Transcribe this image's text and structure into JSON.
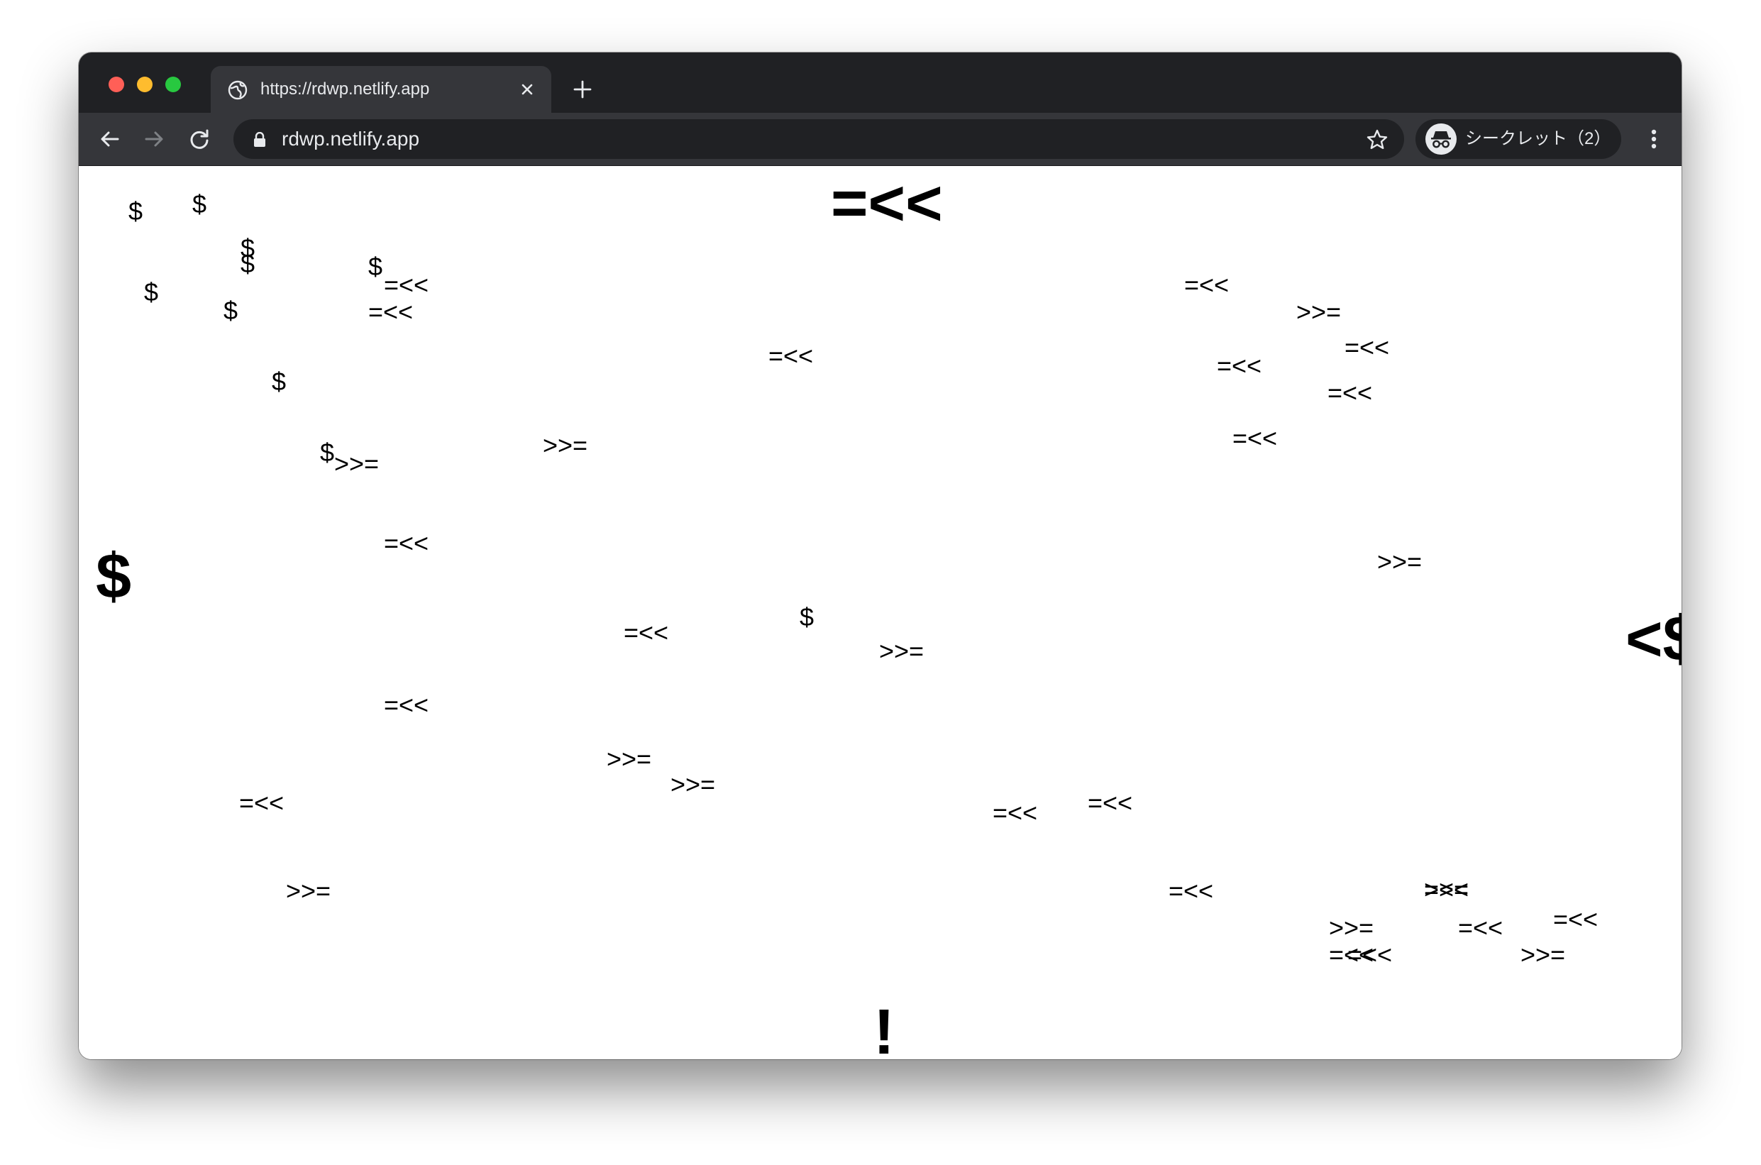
{
  "browser": {
    "tab": {
      "title": "https://rdwp.netlify.app",
      "icon": "globe-icon"
    },
    "omnibox": {
      "url": "rdwp.netlify.app"
    },
    "profile": {
      "label": "シークレット（2）",
      "icon": "incognito-icon"
    }
  },
  "page": {
    "glyphs": {
      "top_title": "=<<",
      "dollar_large": "$",
      "edge_fragment": "<$",
      "bottom_bang": "!",
      "dollars": [
        "$",
        "$",
        "$",
        "$",
        "$",
        "$",
        "$",
        "$",
        "$",
        "$"
      ],
      "arrows_left": [
        "=<<",
        "=<<",
        "=<<",
        "=<<",
        "=<<",
        "=<<",
        "=<<",
        "=<<",
        "=<<",
        "=<<",
        "=<<",
        "=<<",
        "=<<",
        "=<<",
        "=<<",
        "=<<",
        "=<<",
        "=<<",
        "=<<",
        "=<<"
      ],
      "arrows_right": [
        ">>=",
        ">>=",
        ">>=",
        ">>=",
        ">>=",
        ">>=",
        ">>=",
        ">>=",
        ">>=",
        ">>=",
        ">>="
      ]
    }
  }
}
